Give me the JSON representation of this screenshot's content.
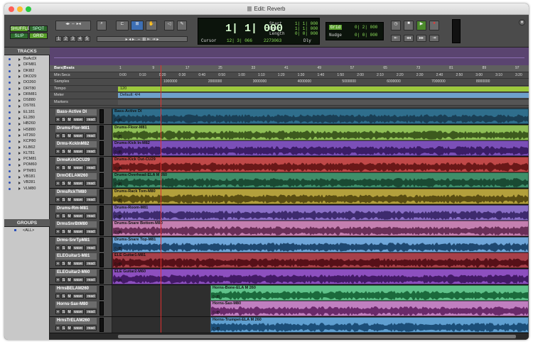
{
  "window": {
    "title": "Edit: Reverb"
  },
  "modes": {
    "shuffle": "SHUFFLE",
    "spot": "SPOT",
    "slip": "SLIP",
    "grid": "GRID"
  },
  "zoom_presets": [
    "1",
    "2",
    "3",
    "4",
    "5"
  ],
  "counters": {
    "main": "1| 1| 000",
    "cursor_label": "Cursor",
    "cursor_value": "12| 3| 066",
    "samples_value": "2273063",
    "start_label": "Start",
    "start_value": "1| 1| 000",
    "end_label": "End",
    "end_value": "1| 1| 000",
    "length_label": "Length",
    "length_value": "0| 0| 000",
    "dly_label": "Dly",
    "grid_label": "Grid",
    "grid_value": "0| 2| 000",
    "nudge_label": "Nudge",
    "nudge_value": "0| 0| 000"
  },
  "tracks_panel": {
    "header": "TRACKS",
    "items": [
      "BsAcDI",
      "DFM81",
      "DKI82",
      "DKO29",
      "DO260",
      "DRT80",
      "DRM81",
      "DS880",
      "DST81",
      "EL181",
      "EL280",
      "HB260",
      "HS880",
      "HT260",
      "KCP80",
      "KLB62",
      "KLT81",
      "PCM81",
      "POM60",
      "PTM81",
      "VB181",
      "VB281",
      "VLM80"
    ]
  },
  "groups_panel": {
    "header": "GROUPS",
    "items": [
      "<ALL>"
    ]
  },
  "rulers": {
    "bars_label": "Bars|Beats",
    "bars_ticks": [
      "1",
      "9",
      "17",
      "25",
      "33",
      "41",
      "49",
      "57",
      "65",
      "73",
      "81",
      "89",
      "97"
    ],
    "minsecs_label": "Min:Secs",
    "minsecs_ticks": [
      "0:00",
      "0:10",
      "0:20",
      "0:30",
      "0:40",
      "0:50",
      "1:00",
      "1:10",
      "1:20",
      "1:30",
      "1:40",
      "1:50",
      "2:00",
      "2:10",
      "2:20",
      "2:30",
      "2:40",
      "2:50",
      "3:00",
      "3:10",
      "3:20"
    ],
    "samples_label": "Samples",
    "samples_ticks": [
      "1000000",
      "2000000",
      "3000000",
      "4000000",
      "5000000",
      "6000000",
      "7000000",
      "8000000"
    ],
    "tempo_label": "Tempo",
    "tempo_value": "120",
    "meter_label": "Meter",
    "meter_value": "Default: 4/4",
    "markers_label": "Markers"
  },
  "track_buttons": {
    "rec": "•",
    "solo": "S",
    "mute": "M",
    "view": "wave",
    "auto": "read"
  },
  "tracks": [
    {
      "name": "Bass-Active DI",
      "clip": "Bass-Active DI",
      "db": "0 dB",
      "color": "#2f6e8c",
      "wave": "#1a3f55"
    },
    {
      "name": "Drums-Flor-M81",
      "clip": "Drums-Floor-M81",
      "db": "0 dB",
      "color": "#8fbf56",
      "wave": "#3d5a1e"
    },
    {
      "name": "Drms-KckInM82",
      "clip": "Drums-Kick In-M82",
      "db": "0 dB",
      "color": "#7b4fb8",
      "wave": "#3b1d66"
    },
    {
      "name": "DrmsKckOCU29",
      "clip": "Drums-Kick Out-CU29",
      "db": "0 dB",
      "color": "#c04848",
      "wave": "#6a1818"
    },
    {
      "name": "DrmOELAM260",
      "clip": "Drums-Overhead-ELA M 260",
      "db": "0 dB",
      "color": "#3f8f6a",
      "wave": "#1a4a33"
    },
    {
      "name": "DrmsRckTM80",
      "clip": "Drums-Rack Tom-M80",
      "db": "0 dB",
      "color": "#b3a03c",
      "wave": "#5a4e12"
    },
    {
      "name": "Drums-Rm-M81",
      "clip": "Drums-Room-M81",
      "db": "0 dB",
      "color": "#8a6fc7",
      "wave": "#3e2b6e"
    },
    {
      "name": "DrmsSnrBtM80",
      "clip": "Drums-Snare Bottom-M80",
      "db": "0 dB",
      "color": "#c47fb0",
      "wave": "#6a2f58"
    },
    {
      "name": "Drms-SnrTpM81",
      "clip": "Drums-Snare Top-M81",
      "db": "0 dB",
      "color": "#6fa6d9",
      "wave": "#1e4870"
    },
    {
      "name": "ELEGuitar1-M81",
      "clip": "ELE Guitar1-M81",
      "db": "0 dB",
      "color": "#a8404a",
      "wave": "#561018"
    },
    {
      "name": "ELEGuitar2-M60",
      "clip": "ELE Guitar2-M60",
      "db": "0 dB",
      "color": "#8d4fbf",
      "wave": "#431a66"
    },
    {
      "name": "HrnsBELAM260",
      "clip": "Horns-Bone-ELA M 260",
      "db": "0 dB",
      "color": "#5fc28a",
      "wave": "#1b6a3c"
    },
    {
      "name": "Horns-Sax-M80",
      "clip": "Horns-Sax-M80",
      "db": "0 dB",
      "color": "#c07fc0",
      "wave": "#6a2a6a"
    },
    {
      "name": "HrnsTrELAM260",
      "clip": "Horns-Trumpet-ELA M 260",
      "db": "0 dB",
      "color": "#5f9fd0",
      "wave": "#1b4e78"
    }
  ],
  "colors": {
    "accent": "#3d6fb4",
    "counter_text": "#8ee25a",
    "overview": "#5a4470",
    "tempo": "#9cc83c"
  }
}
